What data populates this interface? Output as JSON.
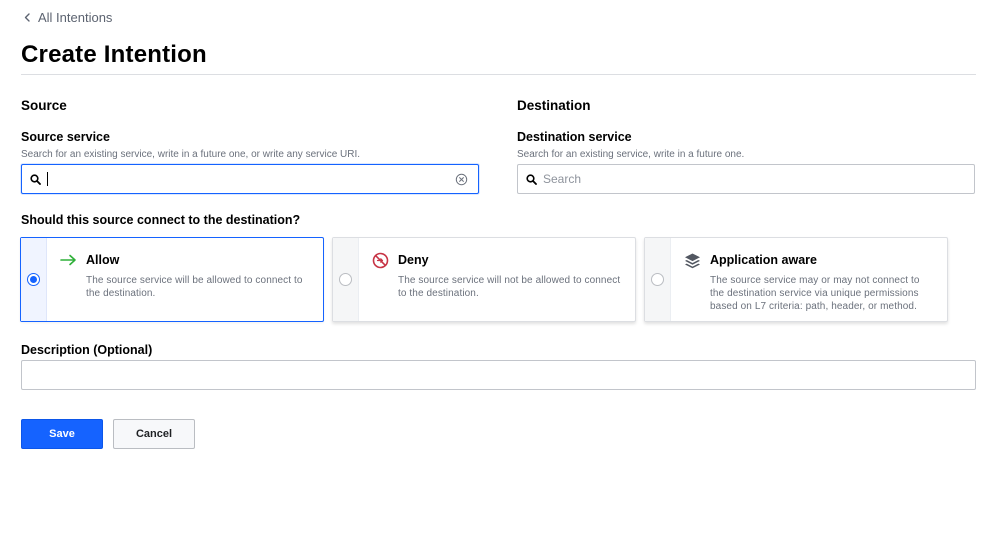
{
  "breadcrumb": {
    "label": "All Intentions",
    "icon": "chevron-left-icon"
  },
  "page": {
    "title": "Create Intention"
  },
  "source": {
    "heading": "Source",
    "label": "Source service",
    "help": "Search for an existing service, write in a future one, or write any service URI.",
    "value": "",
    "icons": [
      "search-icon",
      "clear-icon"
    ]
  },
  "destination": {
    "heading": "Destination",
    "label": "Destination service",
    "help": "Search for an existing service, write in a future one.",
    "placeholder": "Search",
    "icons": [
      "search-icon"
    ]
  },
  "action": {
    "question": "Should this source connect to the destination?",
    "selected": "allow",
    "options": [
      {
        "id": "allow",
        "title": "Allow",
        "description": "The source service will be allowed to connect to the destination.",
        "icon": "arrow-right-icon",
        "color": "#2eb039"
      },
      {
        "id": "deny",
        "title": "Deny",
        "description": "The source service will not be allowed to connect to the destination.",
        "icon": "deny-icon",
        "color": "#c73445"
      },
      {
        "id": "app-aware",
        "title": "Application aware",
        "description": "The source service may or may not connect to the destination service via unique permissions based on L7 criteria: path, header, or method.",
        "icon": "layers-icon",
        "color": "#525761"
      }
    ]
  },
  "description": {
    "label": "Description (Optional)",
    "value": ""
  },
  "buttons": {
    "save": "Save",
    "cancel": "Cancel"
  },
  "colors": {
    "accent": "#1563ff",
    "border": "#c2c5cb",
    "muted_text": "#6b717c"
  }
}
